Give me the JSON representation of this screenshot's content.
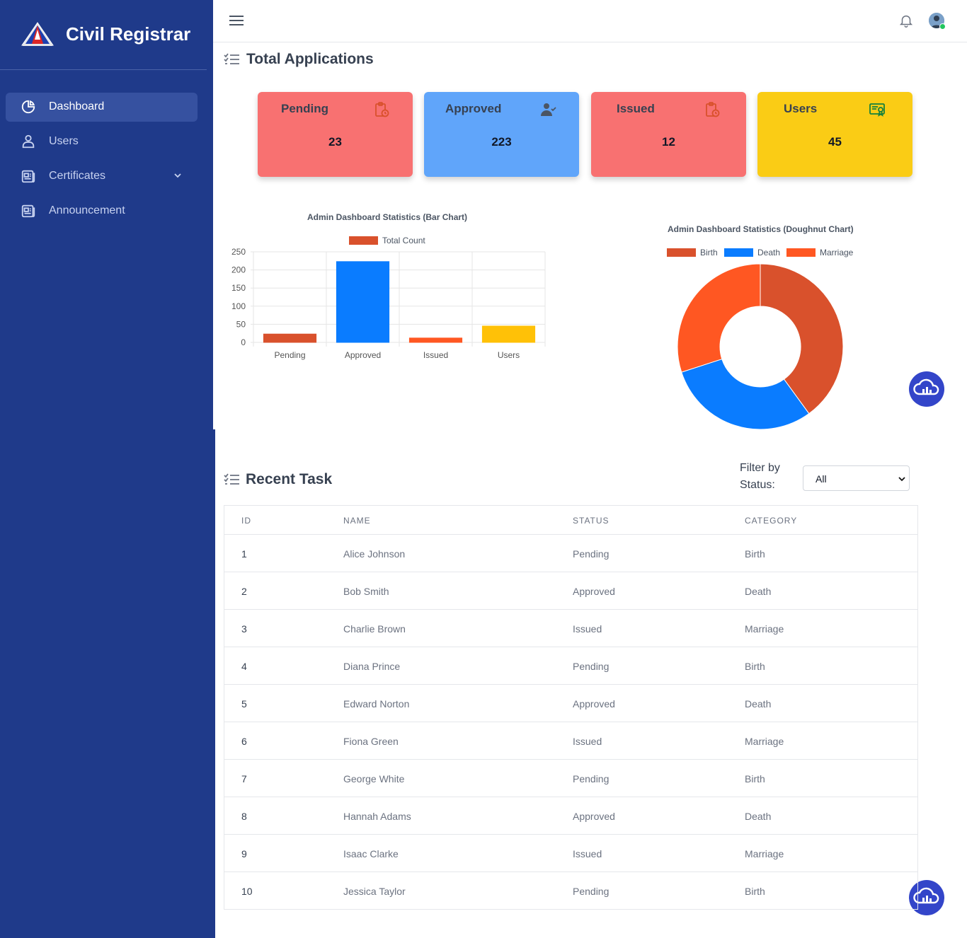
{
  "app": {
    "title": "Civil Registrar"
  },
  "sidebar": {
    "items": [
      {
        "label": "Dashboard",
        "icon": "pie-chart-icon",
        "active": true
      },
      {
        "label": "Users",
        "icon": "user-icon"
      },
      {
        "label": "Certificates",
        "icon": "document-icon",
        "expandable": true
      },
      {
        "label": "Announcement",
        "icon": "newspaper-icon"
      }
    ]
  },
  "colors": {
    "sidebar": "#1f3a8a",
    "pending": "#f87171",
    "approved": "#60a5fa",
    "issued": "#f87171",
    "users": "#facc15",
    "fab": "#3345c9"
  },
  "total_applications": {
    "title": "Total Applications",
    "cards": [
      {
        "label": "Pending",
        "value": "23",
        "icon": "clipboard-clock-icon"
      },
      {
        "label": "Approved",
        "value": "223",
        "icon": "user-check-icon"
      },
      {
        "label": "Issued",
        "value": "12",
        "icon": "clipboard-clock-icon"
      },
      {
        "label": "Users",
        "value": "45",
        "icon": "certificate-icon"
      }
    ]
  },
  "chart_data": [
    {
      "type": "bar",
      "title": "Admin Dashboard Statistics (Bar Chart)",
      "categories": [
        "Pending",
        "Approved",
        "Issued",
        "Users"
      ],
      "series": [
        {
          "name": "Total Count",
          "values": [
            23,
            223,
            12,
            45
          ]
        }
      ],
      "colors": [
        "#d9512c",
        "#0a7cff",
        "#ff5722",
        "#ffc107"
      ],
      "ylim": [
        0,
        250
      ],
      "yticks": [
        "250",
        "200",
        "150",
        "100",
        "50",
        "0"
      ],
      "legend": "top",
      "grid": true
    },
    {
      "type": "pie",
      "title": "Admin Dashboard Statistics (Doughnut Chart)",
      "labels": [
        "Birth",
        "Death",
        "Marriage"
      ],
      "values": [
        40,
        30,
        30
      ],
      "colors": [
        "#d9512c",
        "#0a7cff",
        "#ff5722"
      ],
      "legend": "top"
    }
  ],
  "recent_task": {
    "title": "Recent Task",
    "filter_label": "Filter by Status:",
    "filter_value": "All",
    "columns": [
      "ID",
      "NAME",
      "STATUS",
      "CATEGORY"
    ],
    "rows": [
      [
        "1",
        "Alice Johnson",
        "Pending",
        "Birth"
      ],
      [
        "2",
        "Bob Smith",
        "Approved",
        "Death"
      ],
      [
        "3",
        "Charlie Brown",
        "Issued",
        "Marriage"
      ],
      [
        "4",
        "Diana Prince",
        "Pending",
        "Birth"
      ],
      [
        "5",
        "Edward Norton",
        "Approved",
        "Death"
      ],
      [
        "6",
        "Fiona Green",
        "Issued",
        "Marriage"
      ],
      [
        "7",
        "George White",
        "Pending",
        "Birth"
      ],
      [
        "8",
        "Hannah Adams",
        "Approved",
        "Death"
      ],
      [
        "9",
        "Isaac Clarke",
        "Issued",
        "Marriage"
      ],
      [
        "10",
        "Jessica Taylor",
        "Pending",
        "Birth"
      ]
    ]
  }
}
